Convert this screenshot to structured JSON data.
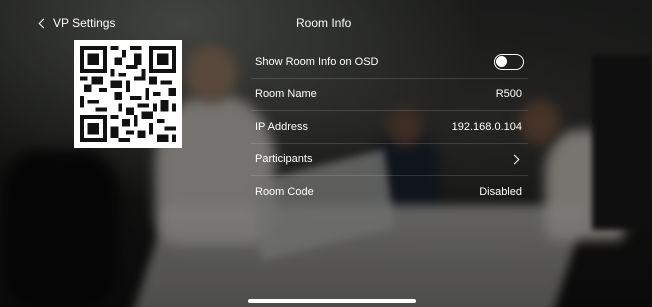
{
  "nav": {
    "back_label": "VP Settings",
    "title": "Room Info"
  },
  "qr": {
    "icon": "qr-code-icon"
  },
  "rows": [
    {
      "label": "Show Room Info on OSD",
      "type": "toggle",
      "toggle_state": "off"
    },
    {
      "label": "Room Name",
      "value": "R500"
    },
    {
      "label": "IP Address",
      "value": "192.168.0.104"
    },
    {
      "label": "Participants",
      "type": "link",
      "icon": "chevron-right-icon"
    },
    {
      "label": "Room Code",
      "value": "Disabled"
    }
  ],
  "colors": {
    "text": "#ffffff",
    "background": "#1e1f1d"
  }
}
